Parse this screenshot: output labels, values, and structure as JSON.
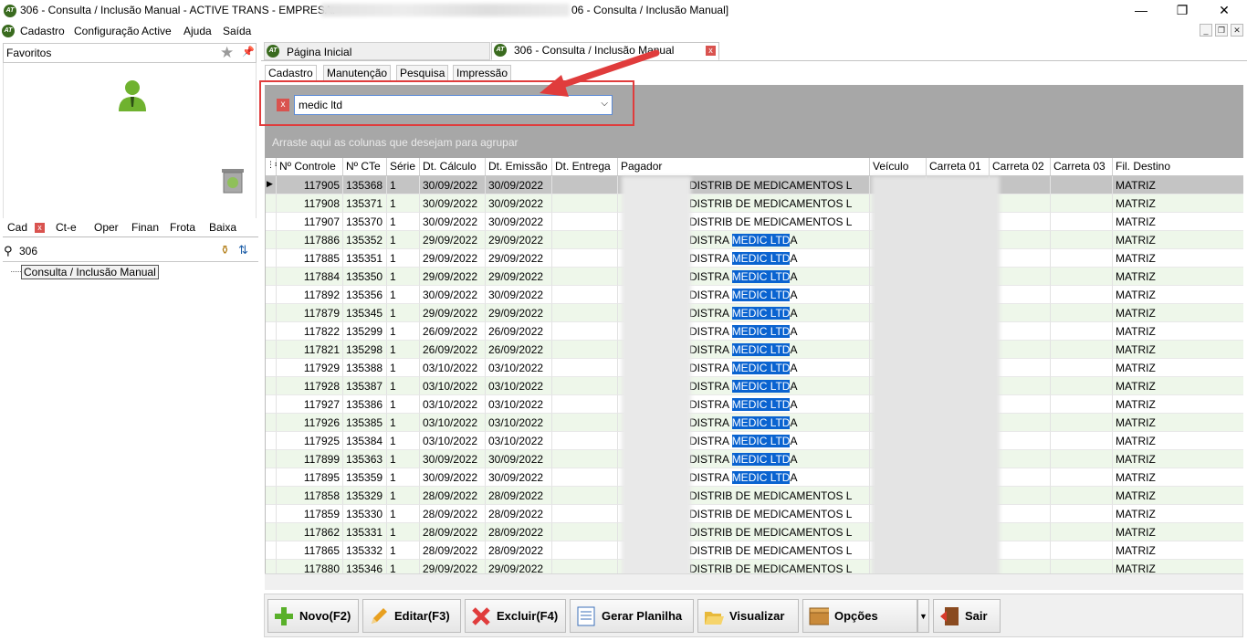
{
  "window": {
    "logo": "AT",
    "title_left": "306 - Consulta / Inclusão Manual - ACTIVE TRANS - EMPRESA:",
    "title_right": "06 - Consulta / Inclusão Manual]",
    "minimize": "—",
    "maximize": "❐",
    "close": "✕"
  },
  "menu": [
    "Cadastro",
    "Configuração Active",
    "Ajuda",
    "Saída"
  ],
  "left": {
    "favorites_label": "Favoritos",
    "tabs": [
      "Cad",
      "Ct-e",
      "Oper",
      "Finan",
      "Frota",
      "Baixa"
    ],
    "search_value": "306",
    "tree_node": "Consulta / Inclusão Manual"
  },
  "page_tabs": [
    "Página Inicial",
    "306 - Consulta / Inclusão Manual"
  ],
  "inner_tabs": [
    "Cadastro",
    "Manutenção",
    "Pesquisa",
    "Impressão"
  ],
  "filter": {
    "value": "medic ltd",
    "clear": "x"
  },
  "group_hint": "Arraste aqui as colunas que desejam para agrupar",
  "grid": {
    "columns": [
      "Nº Controle",
      "Nº CTe",
      "Série",
      "Dt. Cálculo",
      "Dt. Emissão",
      "Dt. Entrega",
      "Pagador",
      "Veículo",
      "Carreta 01",
      "Carreta 02",
      "Carreta 03",
      "Fil. Destino"
    ],
    "rows": [
      {
        "controle": "117905",
        "cte": "135368",
        "serie": "1",
        "calculo": "30/09/2022",
        "emissao": "30/09/2022",
        "pag_pre": "DISTRIB DE MEDICAMENTOS L",
        "pag_hl": "",
        "pag_post": "",
        "destino": "MATRIZ"
      },
      {
        "controle": "117908",
        "cte": "135371",
        "serie": "1",
        "calculo": "30/09/2022",
        "emissao": "30/09/2022",
        "pag_pre": "DISTRIB DE MEDICAMENTOS L",
        "pag_hl": "",
        "pag_post": "",
        "destino": "MATRIZ"
      },
      {
        "controle": "117907",
        "cte": "135370",
        "serie": "1",
        "calculo": "30/09/2022",
        "emissao": "30/09/2022",
        "pag_pre": "DISTRIB DE MEDICAMENTOS L",
        "pag_hl": "",
        "pag_post": "",
        "destino": "MATRIZ"
      },
      {
        "controle": "117886",
        "cte": "135352",
        "serie": "1",
        "calculo": "29/09/2022",
        "emissao": "29/09/2022",
        "pag_pre": "DISTRA ",
        "pag_hl": "MEDIC LTD",
        "pag_post": "A",
        "destino": "MATRIZ"
      },
      {
        "controle": "117885",
        "cte": "135351",
        "serie": "1",
        "calculo": "29/09/2022",
        "emissao": "29/09/2022",
        "pag_pre": "DISTRA ",
        "pag_hl": "MEDIC LTD",
        "pag_post": "A",
        "destino": "MATRIZ"
      },
      {
        "controle": "117884",
        "cte": "135350",
        "serie": "1",
        "calculo": "29/09/2022",
        "emissao": "29/09/2022",
        "pag_pre": "DISTRA ",
        "pag_hl": "MEDIC LTD",
        "pag_post": "A",
        "destino": "MATRIZ"
      },
      {
        "controle": "117892",
        "cte": "135356",
        "serie": "1",
        "calculo": "30/09/2022",
        "emissao": "30/09/2022",
        "pag_pre": "DISTRA ",
        "pag_hl": "MEDIC LTD",
        "pag_post": "A",
        "destino": "MATRIZ"
      },
      {
        "controle": "117879",
        "cte": "135345",
        "serie": "1",
        "calculo": "29/09/2022",
        "emissao": "29/09/2022",
        "pag_pre": "DISTRA ",
        "pag_hl": "MEDIC LTD",
        "pag_post": "A",
        "destino": "MATRIZ"
      },
      {
        "controle": "117822",
        "cte": "135299",
        "serie": "1",
        "calculo": "26/09/2022",
        "emissao": "26/09/2022",
        "pag_pre": "DISTRA ",
        "pag_hl": "MEDIC LTD",
        "pag_post": "A",
        "destino": "MATRIZ"
      },
      {
        "controle": "117821",
        "cte": "135298",
        "serie": "1",
        "calculo": "26/09/2022",
        "emissao": "26/09/2022",
        "pag_pre": "DISTRA ",
        "pag_hl": "MEDIC LTD",
        "pag_post": "A",
        "destino": "MATRIZ"
      },
      {
        "controle": "117929",
        "cte": "135388",
        "serie": "1",
        "calculo": "03/10/2022",
        "emissao": "03/10/2022",
        "pag_pre": "DISTRA ",
        "pag_hl": "MEDIC LTD",
        "pag_post": "A",
        "destino": "MATRIZ"
      },
      {
        "controle": "117928",
        "cte": "135387",
        "serie": "1",
        "calculo": "03/10/2022",
        "emissao": "03/10/2022",
        "pag_pre": "DISTRA ",
        "pag_hl": "MEDIC LTD",
        "pag_post": "A",
        "destino": "MATRIZ"
      },
      {
        "controle": "117927",
        "cte": "135386",
        "serie": "1",
        "calculo": "03/10/2022",
        "emissao": "03/10/2022",
        "pag_pre": "DISTRA ",
        "pag_hl": "MEDIC LTD",
        "pag_post": "A",
        "destino": "MATRIZ"
      },
      {
        "controle": "117926",
        "cte": "135385",
        "serie": "1",
        "calculo": "03/10/2022",
        "emissao": "03/10/2022",
        "pag_pre": "DISTRA ",
        "pag_hl": "MEDIC LTD",
        "pag_post": "A",
        "destino": "MATRIZ"
      },
      {
        "controle": "117925",
        "cte": "135384",
        "serie": "1",
        "calculo": "03/10/2022",
        "emissao": "03/10/2022",
        "pag_pre": "DISTRA ",
        "pag_hl": "MEDIC LTD",
        "pag_post": "A",
        "destino": "MATRIZ"
      },
      {
        "controle": "117899",
        "cte": "135363",
        "serie": "1",
        "calculo": "30/09/2022",
        "emissao": "30/09/2022",
        "pag_pre": "DISTRA ",
        "pag_hl": "MEDIC LTD",
        "pag_post": "A",
        "destino": "MATRIZ"
      },
      {
        "controle": "117895",
        "cte": "135359",
        "serie": "1",
        "calculo": "30/09/2022",
        "emissao": "30/09/2022",
        "pag_pre": "DISTRA ",
        "pag_hl": "MEDIC LTD",
        "pag_post": "A",
        "destino": "MATRIZ"
      },
      {
        "controle": "117858",
        "cte": "135329",
        "serie": "1",
        "calculo": "28/09/2022",
        "emissao": "28/09/2022",
        "pag_pre": "DISTRIB DE MEDICAMENTOS L",
        "pag_hl": "",
        "pag_post": "",
        "destino": "MATRIZ"
      },
      {
        "controle": "117859",
        "cte": "135330",
        "serie": "1",
        "calculo": "28/09/2022",
        "emissao": "28/09/2022",
        "pag_pre": "DISTRIB DE MEDICAMENTOS L",
        "pag_hl": "",
        "pag_post": "",
        "destino": "MATRIZ"
      },
      {
        "controle": "117862",
        "cte": "135331",
        "serie": "1",
        "calculo": "28/09/2022",
        "emissao": "28/09/2022",
        "pag_pre": "DISTRIB DE MEDICAMENTOS L",
        "pag_hl": "",
        "pag_post": "",
        "destino": "MATRIZ"
      },
      {
        "controle": "117865",
        "cte": "135332",
        "serie": "1",
        "calculo": "28/09/2022",
        "emissao": "28/09/2022",
        "pag_pre": "DISTRIB DE MEDICAMENTOS L",
        "pag_hl": "",
        "pag_post": "",
        "destino": "MATRIZ"
      },
      {
        "controle": "117880",
        "cte": "135346",
        "serie": "1",
        "calculo": "29/09/2022",
        "emissao": "29/09/2022",
        "pag_pre": "DISTRIB DE MEDICAMENTOS L",
        "pag_hl": "",
        "pag_post": "",
        "destino": "MATRIZ"
      }
    ]
  },
  "toolbar": {
    "novo": "Novo(F2)",
    "editar": "Editar(F3)",
    "excluir": "Excluir(F4)",
    "planilha": "Gerar Planilha",
    "visualizar": "Visualizar",
    "opcoes": "Opções",
    "sair": "Sair"
  },
  "colors": {
    "accent_green": "#3a6b1f",
    "highlight": "#0a63d0",
    "annotation_red": "#e03c3c",
    "row_alt": "#eef7ea",
    "row_selected": "#c4c4c4"
  }
}
